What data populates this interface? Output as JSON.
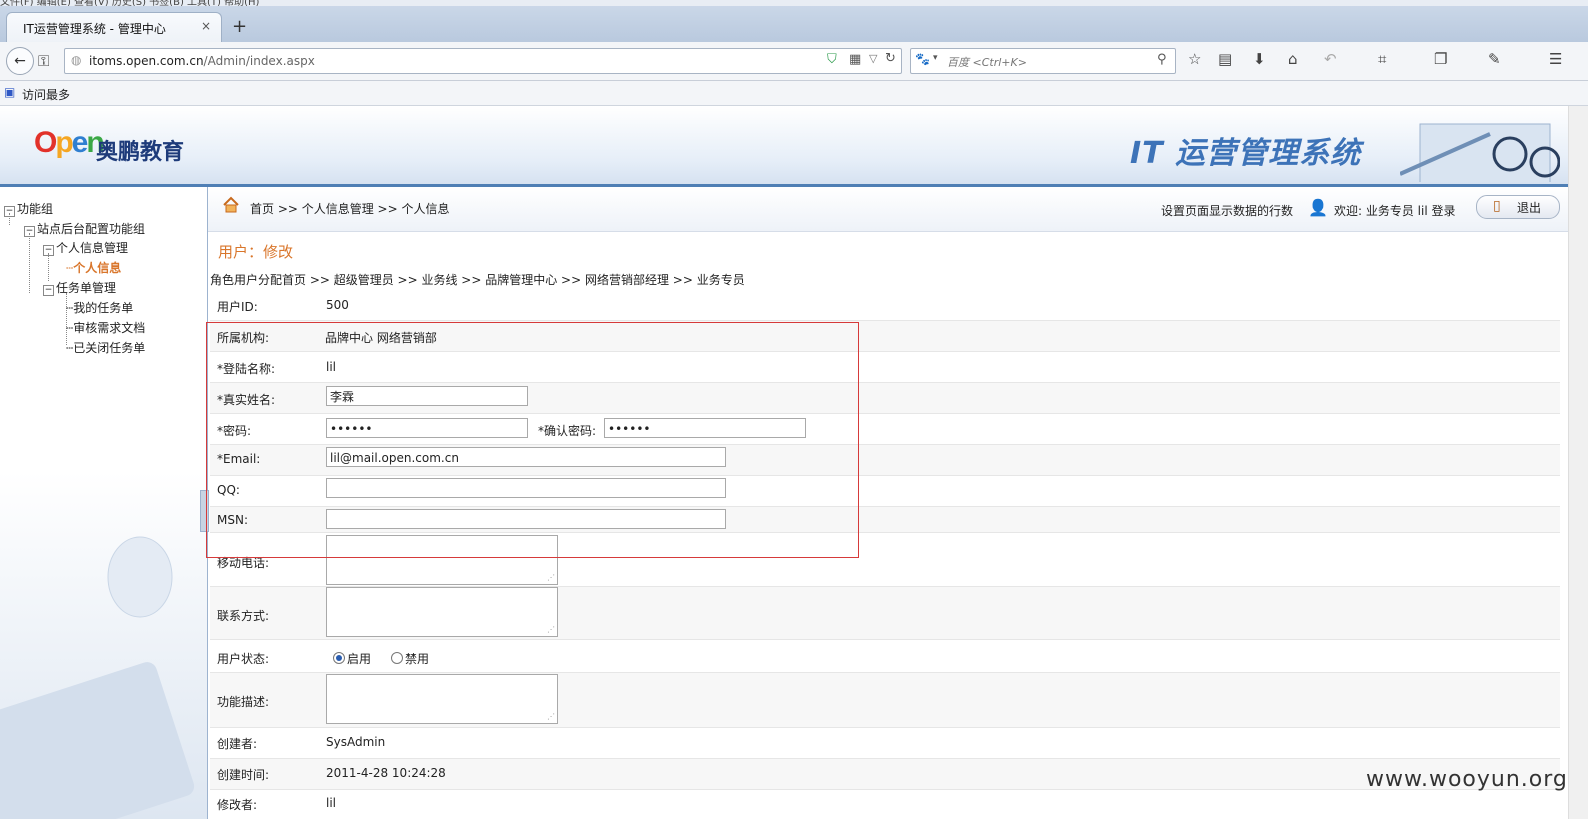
{
  "browser": {
    "menu_text": "文件(F)  编辑(E)  查看(V)  历史(S)  书签(B)  工具(T)  帮助(H)",
    "tab_title": "IT运营管理系统 - 管理中心",
    "tab_close": "×",
    "new_tab": "+",
    "url_host": "itoms.open.com.cn",
    "url_path": "/Admin/index.aspx",
    "search_placeholder": "百度 <Ctrl+K>",
    "bookmark_label": "访问最多"
  },
  "header": {
    "logo_text": "Open",
    "logo_cn": "奥鹏教育",
    "system_title": "IT 运营管理系统"
  },
  "sidebar": {
    "root": "功能组",
    "group": "站点后台配置功能组",
    "items": [
      {
        "label": "个人信息管理"
      },
      {
        "label": "个人信息"
      },
      {
        "label": "任务单管理"
      },
      {
        "label": "我的任务单"
      },
      {
        "label": "审核需求文档"
      },
      {
        "label": "已关闭任务单"
      }
    ]
  },
  "topbar": {
    "breadcrumb": "首页 >> 个人信息管理 >> 个人信息",
    "rows_setting": "设置页面显示数据的行数",
    "welcome": "欢迎: 业务专员 lil 登录",
    "logout": "退出"
  },
  "page": {
    "title": "用户：修改",
    "role_path": "角色用户分配首页 >> 超级管理员 >> 业务线 >> 品牌管理中心 >> 网络营销部经理 >> 业务专员"
  },
  "form": {
    "user_id_label": "用户ID:",
    "user_id": "500",
    "org_label": "所属机构:",
    "org": "品牌中心 网络营销部",
    "login_label": "*登陆名称:",
    "login": "lil",
    "realname_label": "*真实姓名:",
    "realname": "李霖",
    "password_label": "*密码:",
    "password": "••••••",
    "confirm_label": "*确认密码:",
    "confirm": "••••••",
    "email_label": "*Email:",
    "email": "lil@mail.open.com.cn",
    "qq_label": "QQ:",
    "qq": "",
    "msn_label": "MSN:",
    "msn": "",
    "mobile_label": "移动电话:",
    "contact_label": "联系方式:",
    "status_label": "用户状态:",
    "status_on": "启用",
    "status_off": "禁用",
    "desc_label": "功能描述:",
    "creator_label": "创建者:",
    "creator": "SysAdmin",
    "created_label": "创建时间:",
    "created": "2011-4-28 10:24:28",
    "modifier_label": "修改者:",
    "modifier": "lil"
  },
  "watermark": "www.wooyun.org",
  "colors": {
    "accent": "#d9762b",
    "highlight_box": "#d63a3a",
    "header_border": "#4f7fb5"
  }
}
